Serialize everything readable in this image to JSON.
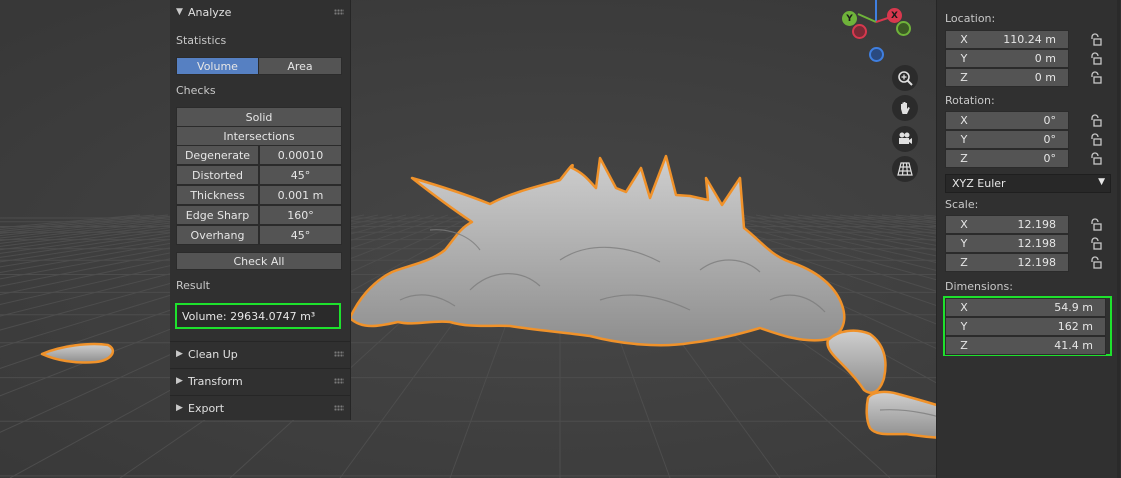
{
  "analyze": {
    "title": "Analyze",
    "statistics_label": "Statistics",
    "stat_tabs": [
      "Volume",
      "Area"
    ],
    "checks_label": "Checks",
    "solid_label": "Solid",
    "intersections_label": "Intersections",
    "checks": [
      {
        "name": "Degenerate",
        "value": "0.00010"
      },
      {
        "name": "Distorted",
        "value": "45°"
      },
      {
        "name": "Thickness",
        "value": "0.001 m"
      },
      {
        "name": "Edge Sharp",
        "value": "160°"
      },
      {
        "name": "Overhang",
        "value": "45°"
      }
    ],
    "check_all_label": "Check All",
    "result_label": "Result",
    "result_value": "Volume: 29634.0747 m³"
  },
  "collapsed_panels": [
    "Clean Up",
    "Transform",
    "Export"
  ],
  "gizmo": {
    "y": "Y",
    "x": "X"
  },
  "transform": {
    "location_label": "Location:",
    "location": [
      {
        "axis": "X",
        "value": "110.24 m"
      },
      {
        "axis": "Y",
        "value": "0 m"
      },
      {
        "axis": "Z",
        "value": "0 m"
      }
    ],
    "rotation_label": "Rotation:",
    "rotation": [
      {
        "axis": "X",
        "value": "0°"
      },
      {
        "axis": "Y",
        "value": "0°"
      },
      {
        "axis": "Z",
        "value": "0°"
      }
    ],
    "rotation_mode": "XYZ Euler",
    "scale_label": "Scale:",
    "scale": [
      {
        "axis": "X",
        "value": "12.198"
      },
      {
        "axis": "Y",
        "value": "12.198"
      },
      {
        "axis": "Z",
        "value": "12.198"
      }
    ],
    "dimensions_label": "Dimensions:",
    "dimensions": [
      {
        "axis": "X",
        "value": "54.9 m"
      },
      {
        "axis": "Y",
        "value": "162 m"
      },
      {
        "axis": "Z",
        "value": "41.4 m"
      }
    ]
  },
  "colors": {
    "highlight": "#1ee12d",
    "selection_outline": "#f0922a",
    "active_tab": "#5680c2"
  }
}
